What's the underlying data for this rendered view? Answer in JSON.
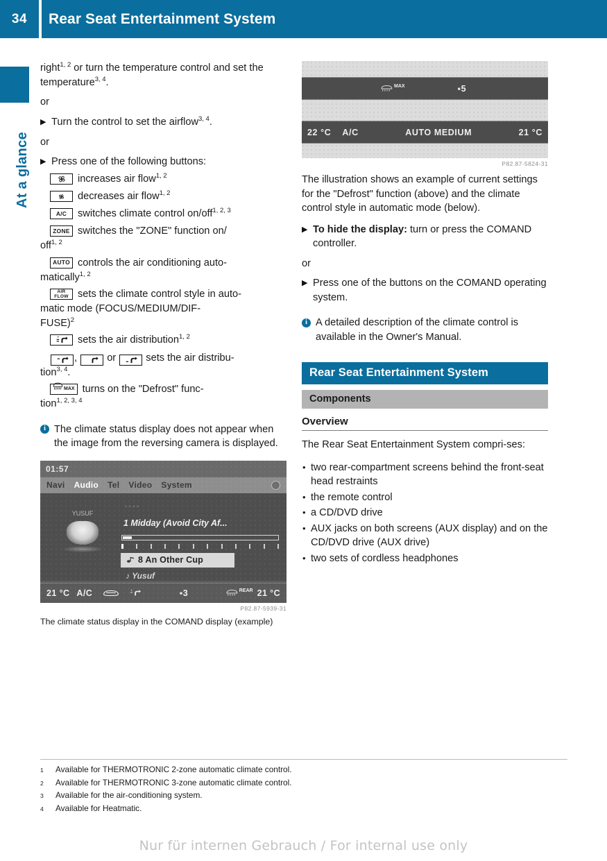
{
  "header": {
    "page_number": "34",
    "title": "Rear Seat Entertainment System",
    "accent_color": "#0a6e9e"
  },
  "sidebar": {
    "label": "At a glance"
  },
  "left_column": {
    "step_continuation": {
      "line1_pre": "right",
      "line1_sup": "1, 2",
      "line1_mid": " or turn the temperature control and",
      "line2_pre": "set the temperature",
      "line2_sup": "3, 4",
      "line2_post": "."
    },
    "or_1": "or",
    "step_airflow": {
      "text_pre": "Turn the control to set the airflow",
      "sup": "3, 4",
      "text_post": "."
    },
    "or_2": "or",
    "step_press_buttons": "Press one of the following buttons:",
    "buttons": [
      {
        "icon": "fan-large-icon",
        "icon_label": "",
        "text": "increases air flow",
        "sup": "1, 2"
      },
      {
        "icon": "fan-small-icon",
        "icon_label": "",
        "text": "decreases air flow",
        "sup": "1, 2"
      },
      {
        "icon": "ac-button-icon",
        "icon_label": "A/C",
        "text": "switches climate control on/off",
        "sup": "1, 2, 3"
      },
      {
        "icon": "zone-button-icon",
        "icon_label": "ZONE",
        "text": "switches the \"ZONE\" function on/",
        "sup": "",
        "cont_pre": "off",
        "cont_sup": "1, 2"
      },
      {
        "icon": "auto-button-icon",
        "icon_label": "AUTO",
        "text": "controls the air conditioning auto-",
        "sup": "",
        "cont_pre": "matically",
        "cont_sup": "1, 2"
      },
      {
        "icon": "airflow-button-icon",
        "icon_label": "AIR FLOW",
        "text": "sets the climate control style in auto-",
        "sup": "",
        "cont_line1": "matic mode (FOCUS/MEDIUM/DIF-",
        "cont_line2_pre": "FUSE)",
        "cont_line2_sup": "2"
      },
      {
        "icon": "air-distribution-icon",
        "icon_label": "",
        "text": "sets the air distribution",
        "sup": "1, 2"
      }
    ],
    "air_distribution_line": {
      "separator_comma": ",",
      "separator_or": "or",
      "text": "sets the air distribu-",
      "cont_pre": "tion",
      "cont_sup": "3, 4",
      "cont_post": "."
    },
    "defrost_line": {
      "icon_label": "MAX",
      "text": "turns on the \"Defrost\" func-",
      "cont_pre": "tion",
      "cont_sup": "1, 2, 3, 4"
    },
    "note": "The climate status display does not appear when the image from the reversing camera is displayed.",
    "comand_screen": {
      "clock": "01:57",
      "menu": [
        "Navi",
        "Audio",
        "Tel",
        "Video",
        "System"
      ],
      "active_menu": "Audio",
      "disc_dots": "◦◦◦◦",
      "track_title": "1 Midday (Avoid City Af...",
      "selected_row": "8 An Other Cup",
      "artist": "Yusuf",
      "cover_label": "YUSUF",
      "status_left_temp": "21 °C",
      "status_ac": "A/C",
      "status_fan": "3",
      "status_right_temp": "21 °C",
      "status_rear": "REAR"
    },
    "figure_code": "P82.87-5939-31",
    "figure_caption": "The climate status display in the COMAND display (example)"
  },
  "right_column": {
    "strips_figure": {
      "bar1_defrost_label": "MAX",
      "bar1_fan": "5",
      "bar2_left_temp": "22 °C",
      "bar2_ac": "A/C",
      "bar2_mode": "AUTO MEDIUM",
      "bar2_right_temp": "21 °C",
      "figure_code": "P82.87-5824-31"
    },
    "paragraph_illustration": "The illustration shows an example of current settings for the \"Defrost\" function (above) and the climate control style in automatic mode (below).",
    "step_hide": {
      "bold": "To hide the display:",
      "rest": " turn or press the COMAND controller."
    },
    "or": "or",
    "step_press": "Press one of the buttons on the COMAND operating system.",
    "note": "A detailed description of the climate control is available in the Owner's Manual.",
    "section_bar": "Rear Seat Entertainment System",
    "subsection_bar": "Components",
    "overview_heading": "Overview",
    "overview_intro": "The Rear Seat Entertainment System compri-ses:",
    "overview_intro_display": "The Rear Seat Entertainment System compri‐ses:",
    "bullets": [
      "two rear-compartment screens behind the front-seat head restraints",
      "the remote control",
      "a CD/DVD drive",
      "AUX jacks on both screens (AUX display) and on the CD/DVD drive (AUX drive)",
      "two sets of cordless headphones"
    ]
  },
  "footnotes": [
    {
      "num": "1",
      "text": "Available for THERMOTRONIC 2-zone automatic climate control."
    },
    {
      "num": "2",
      "text": "Available for THERMOTRONIC 3-zone automatic climate control."
    },
    {
      "num": "3",
      "text": "Available for the air-conditioning system."
    },
    {
      "num": "4",
      "text": "Available for Heatmatic."
    }
  ],
  "watermark": "Nur für internen Gebrauch / For internal use only"
}
